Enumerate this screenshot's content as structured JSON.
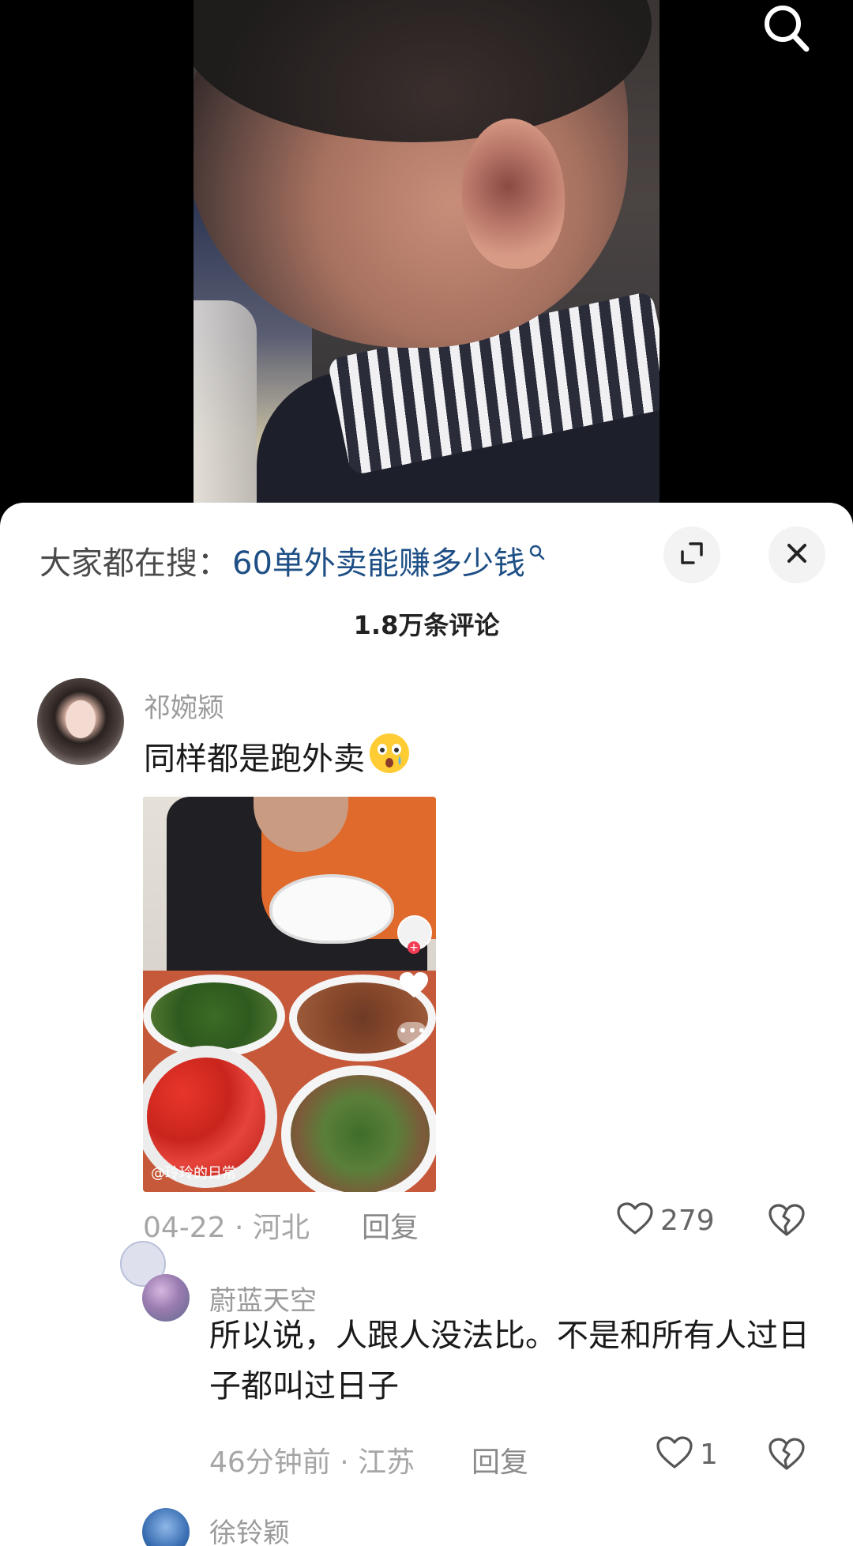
{
  "video": {
    "search_icon": "search-icon"
  },
  "comments_panel": {
    "search_hint_label": "大家都在搜：",
    "search_hint_query": "60单外卖能赚多少钱",
    "expand_icon": "expand-icon",
    "close_icon": "close-icon",
    "title": "1.8万条评论"
  },
  "comments": [
    {
      "username": "祁婉颍",
      "text": "同样都是跑外卖",
      "emoji": "shocked-face-emoji",
      "image_watermark": "@玲玲的日常",
      "meta": "04-22 · 河北",
      "reply_label": "回复",
      "likes": "279"
    },
    {
      "username": "蔚蓝天空",
      "text": "所以说，人跟人没法比。不是和所有人过日子都叫过日子",
      "meta": "46分钟前 · 江苏",
      "reply_label": "回复",
      "likes": "1"
    },
    {
      "username": "徐铃颖"
    }
  ],
  "colors": {
    "accent_link": "#1e4f85",
    "meta_text": "#a6a6a6",
    "username_text": "#9a9a9a"
  }
}
